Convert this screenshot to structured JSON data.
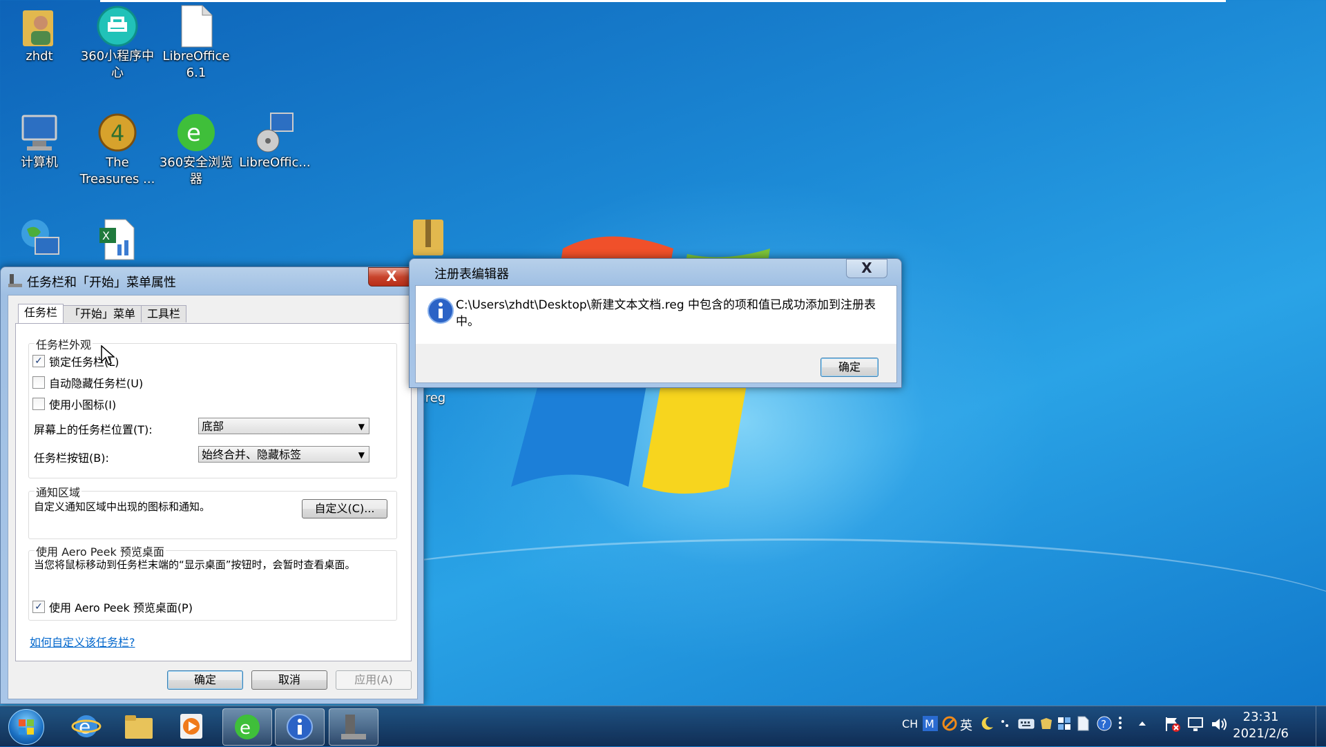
{
  "desktop": {
    "icons": [
      {
        "label": "zhdt"
      },
      {
        "label": "360小程序中心"
      },
      {
        "label": "LibreOffice 6.1"
      },
      {
        "label": "计算机"
      },
      {
        "label": "The Treasures ..."
      },
      {
        "label": "360安全浏览器"
      },
      {
        "label": "LibreOffic..."
      },
      {
        "label": ""
      },
      {
        "label": ""
      },
      {
        "label": ""
      }
    ],
    "partial_file_label": ".reg"
  },
  "taskbar_dialog": {
    "title": "任务栏和「开始」菜单属性",
    "close": "X",
    "tabs": [
      {
        "label": "任务栏"
      },
      {
        "label": "「开始」菜单"
      },
      {
        "label": "工具栏"
      }
    ],
    "appearance": {
      "group_title": "任务栏外观",
      "lock": {
        "label": "锁定任务栏(L)",
        "checked": true
      },
      "autohide": {
        "label": "自动隐藏任务栏(U)",
        "checked": false
      },
      "small_icons": {
        "label": "使用小图标(I)",
        "checked": false
      },
      "position_label": "屏幕上的任务栏位置(T):",
      "position_value": "底部",
      "buttons_label": "任务栏按钮(B):",
      "buttons_value": "始终合并、隐藏标签"
    },
    "notify": {
      "group_title": "通知区域",
      "desc": "自定义通知区域中出现的图标和通知。",
      "customize": "自定义(C)..."
    },
    "peek": {
      "group_title": "使用 Aero Peek 预览桌面",
      "desc": "当您将鼠标移动到任务栏末端的“显示桌面”按钮时，会暂时查看桌面。",
      "checkbox": {
        "label": "使用 Aero Peek 预览桌面(P)",
        "checked": true
      }
    },
    "help_link": "如何自定义该任务栏?",
    "ok": "确定",
    "cancel": "取消",
    "apply": "应用(A)"
  },
  "reg_dialog": {
    "title": "注册表编辑器",
    "close": "X",
    "message": "C:\\Users\\zhdt\\Desktop\\新建文本文档.reg 中包含的项和值已成功添加到注册表中。",
    "ok": "确定"
  },
  "taskbar": {
    "tray": {
      "lang": "CH",
      "ime": "英"
    },
    "clock": {
      "time": "23:31",
      "date": "2021/2/6"
    }
  },
  "colors": {
    "accent": "#1c8ad6",
    "close_red": "#c8452d",
    "link": "#0066cc"
  }
}
